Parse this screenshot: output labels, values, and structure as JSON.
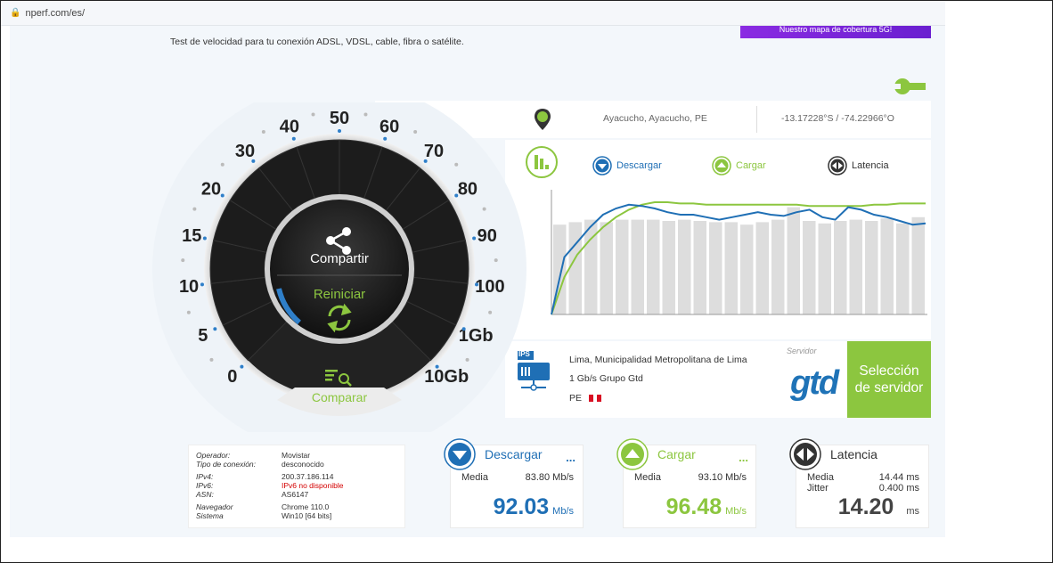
{
  "browser": {
    "url": "nperf.com/es/"
  },
  "header": {
    "tagline": "Test de velocidad para tu conexión ADSL, VDSL, cable, fibra o satélite.",
    "promo": "Nuestro mapa de cobertura 5G!"
  },
  "location": {
    "name": "Ayacucho, Ayacucho, PE",
    "coords": "-13.17228°S / -74.22966°O"
  },
  "legend": {
    "download": "Descargar",
    "upload": "Cargar",
    "latency": "Latencia"
  },
  "gauge": {
    "share_label": "Compartir",
    "restart_label": "Reiniciar",
    "compare_label": "Comparar",
    "scale": [
      "0",
      "5",
      "10",
      "15",
      "20",
      "30",
      "40",
      "50",
      "60",
      "70",
      "80",
      "90",
      "100",
      "1Gb",
      "10Gb"
    ]
  },
  "server": {
    "city": "Lima, Municipalidad Metropolitana de Lima",
    "isp": "1 Gb/s Grupo Gtd",
    "country": "PE",
    "badge": "IPS",
    "label": "Servidor",
    "logo": "gtd",
    "select_button": "Selección de servidor"
  },
  "info": {
    "rows": [
      {
        "k": "Operador:",
        "v": "Movistar"
      },
      {
        "k": "Tipo de conexión:",
        "v": "desconocido"
      },
      {
        "k": "IPv4:",
        "v": "200.37.186.114"
      },
      {
        "k": "IPv6:",
        "v": "IPv6 no disponible"
      },
      {
        "k": "ASN:",
        "v": "AS6147"
      },
      {
        "k": "Navegador",
        "v": "Chrome 110.0"
      },
      {
        "k": "Sistema",
        "v": "Win10 [64 bits]"
      }
    ]
  },
  "results": {
    "download": {
      "title": "Descargar",
      "more": "...",
      "avg_label": "Media",
      "avg_value": "83.80 Mb/s",
      "value": "92.03",
      "unit": "Mb/s",
      "color": "#1f6fb5"
    },
    "upload": {
      "title": "Cargar",
      "more": "...",
      "avg_label": "Media",
      "avg_value": "93.10 Mb/s",
      "value": "96.48",
      "unit": "Mb/s",
      "color": "#8cc63f"
    },
    "latency": {
      "title": "Latencia",
      "avg_label": "Media",
      "avg_value": "14.44 ms",
      "jitter_label": "Jitter",
      "jitter_value": "0.400 ms",
      "value": "14.20",
      "unit": "ms",
      "color": "#333333"
    }
  },
  "colors": {
    "blue": "#1f6fb5",
    "green": "#8cc63f",
    "bars": "#dddddd"
  },
  "chart_data": {
    "type": "line",
    "title": "",
    "ylim": [
      0,
      100
    ],
    "latency_bars": [
      72,
      74,
      76,
      74,
      76,
      76,
      76,
      75,
      76,
      75,
      74,
      74,
      72,
      74,
      76,
      86,
      75,
      73,
      75,
      76,
      75,
      77,
      73,
      78
    ],
    "series": [
      {
        "name": "Descargar",
        "values": [
          0,
          46,
          58,
          70,
          80,
          85,
          88,
          87,
          85,
          82,
          80,
          80,
          78,
          76,
          78,
          80,
          82,
          80,
          79,
          82,
          84,
          78,
          76,
          86,
          84,
          80,
          78,
          75,
          72,
          73
        ]
      },
      {
        "name": "Cargar",
        "values": [
          0,
          30,
          48,
          60,
          70,
          78,
          84,
          88,
          90,
          90,
          89,
          89,
          88,
          88,
          88,
          88,
          88,
          88,
          88,
          88,
          87,
          87,
          87,
          87,
          87,
          88,
          88,
          89,
          89,
          89
        ]
      }
    ]
  }
}
